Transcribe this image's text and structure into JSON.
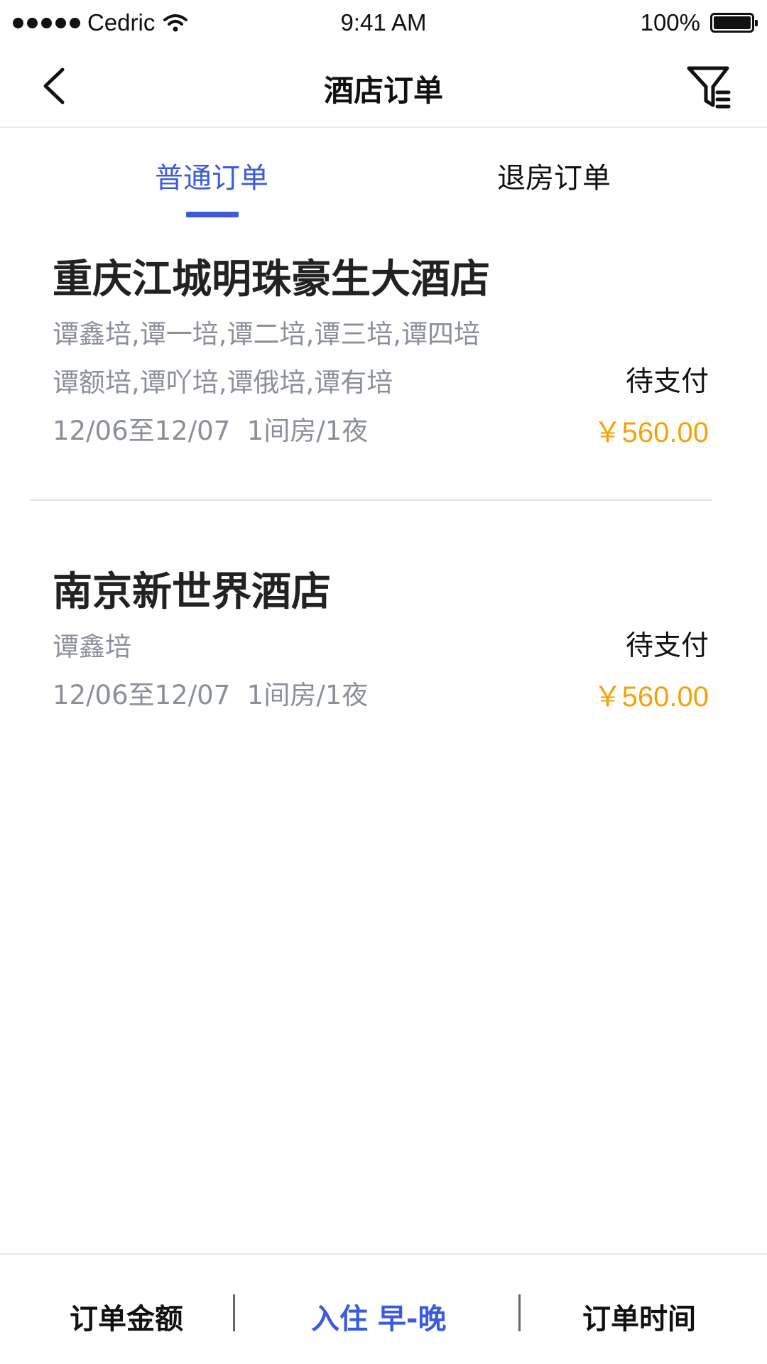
{
  "status_bar": {
    "carrier": "Cedric",
    "time": "9:41 AM",
    "battery": "100%"
  },
  "nav": {
    "title": "酒店订单",
    "back_icon": "chevron-left-icon",
    "filter_icon": "filter-icon"
  },
  "tabs": [
    {
      "label": "普通订单",
      "active": true
    },
    {
      "label": "退房订单",
      "active": false
    }
  ],
  "orders": [
    {
      "hotel": "重庆江城明珠豪生大酒店",
      "guests_line1": "谭鑫培,谭一培,谭二培,谭三培,谭四培",
      "guests_line2": "谭额培,谭吖培,谭俄培,谭有培",
      "status": "待支付",
      "dates": "12/06至12/07",
      "rooms": "1间房/1夜",
      "price": "￥560.00"
    },
    {
      "hotel": "南京新世界酒店",
      "guests_line1": "谭鑫培",
      "status": "待支付",
      "dates": "12/06至12/07",
      "rooms": "1间房/1夜",
      "price": "￥560.00"
    }
  ],
  "bottom_bar": {
    "amount": "订单金额",
    "checkin": "入住 早-晚",
    "time": "订单时间"
  },
  "colors": {
    "accent": "#3b5bdb",
    "price": "#f5a20a",
    "secondary_text": "#8a8f9a"
  }
}
